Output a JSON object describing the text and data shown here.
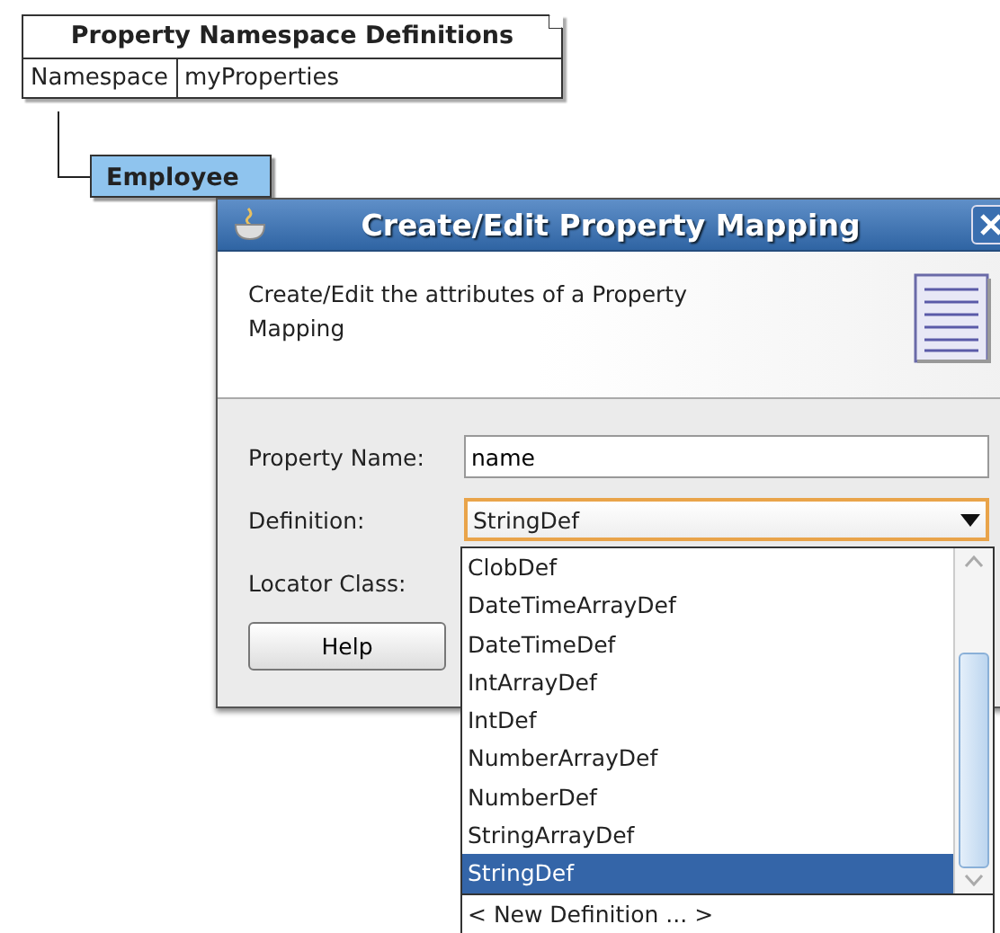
{
  "diagram": {
    "note": {
      "title": "Property Namespace Definitions",
      "rows": [
        {
          "key": "Namespace",
          "value": "myProperties"
        }
      ]
    },
    "entity": {
      "name": "Employee"
    }
  },
  "dialog": {
    "title": "Create/Edit Property Mapping",
    "description": "Create/Edit the attributes of a Property Mapping",
    "fields": [
      {
        "kind": "text",
        "label": "Property Name:",
        "value": "name"
      },
      {
        "kind": "combo",
        "label": "Definition:",
        "value": "StringDef",
        "focused": true
      },
      {
        "kind": "covered",
        "label": "Locator Class:"
      }
    ],
    "buttons": [
      "Help"
    ]
  },
  "dropdown": {
    "options": [
      {
        "label": "ClobDef",
        "selected": false
      },
      {
        "label": "DateTimeArrayDef",
        "selected": false
      },
      {
        "label": "DateTimeDef",
        "selected": false
      },
      {
        "label": "IntArrayDef",
        "selected": false
      },
      {
        "label": "IntDef",
        "selected": false
      },
      {
        "label": "NumberArrayDef",
        "selected": false
      },
      {
        "label": "NumberDef",
        "selected": false
      },
      {
        "label": "StringArrayDef",
        "selected": false
      },
      {
        "label": "StringDef",
        "selected": true
      }
    ],
    "footer": "< New Definition ... >"
  }
}
